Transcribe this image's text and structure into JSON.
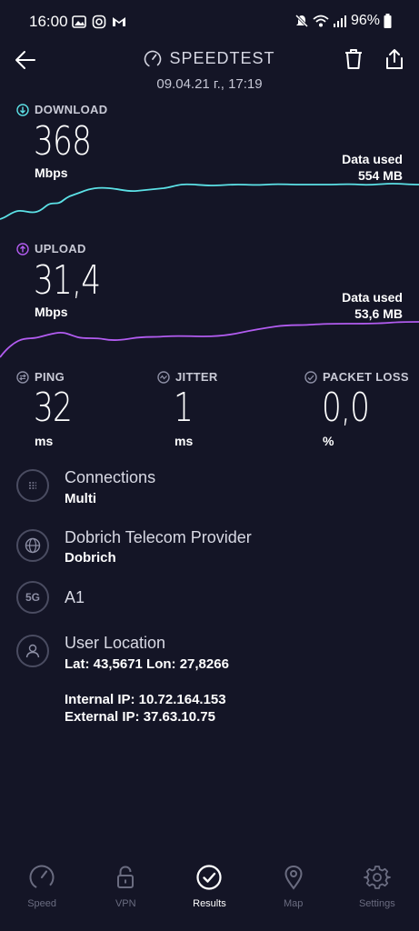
{
  "status_bar": {
    "time": "16:00",
    "battery": "96%"
  },
  "header": {
    "title": "SPEEDTEST",
    "date": "09.04.21 г., 17:19"
  },
  "download": {
    "label": "DOWNLOAD",
    "value": "368",
    "unit": "Mbps",
    "data_used_label": "Data used",
    "data_used_value": "554 MB",
    "color": "#5ce1e6"
  },
  "upload": {
    "label": "UPLOAD",
    "value": "31,4",
    "unit": "Mbps",
    "data_used_label": "Data used",
    "data_used_value": "53,6 MB",
    "color": "#b25cf0"
  },
  "ping": {
    "label": "PING",
    "value": "32",
    "unit": "ms"
  },
  "jitter": {
    "label": "JITTER",
    "value": "1",
    "unit": "ms"
  },
  "packet_loss": {
    "label": "PACKET LOSS",
    "value": "0,0",
    "unit": "%"
  },
  "info": {
    "connections": {
      "title": "Connections",
      "value": "Multi"
    },
    "provider": {
      "title": "Dobrich Telecom Provider",
      "value": "Dobrich"
    },
    "network": {
      "badge": "5G",
      "value": "A1"
    },
    "location": {
      "title": "User Location",
      "coords": "Lat: 43,5671 Lon: 27,8266",
      "internal_ip": "Internal IP: 10.72.164.153",
      "external_ip": "External IP: 37.63.10.75"
    }
  },
  "nav": {
    "speed": "Speed",
    "vpn": "VPN",
    "results": "Results",
    "map": "Map",
    "settings": "Settings"
  }
}
